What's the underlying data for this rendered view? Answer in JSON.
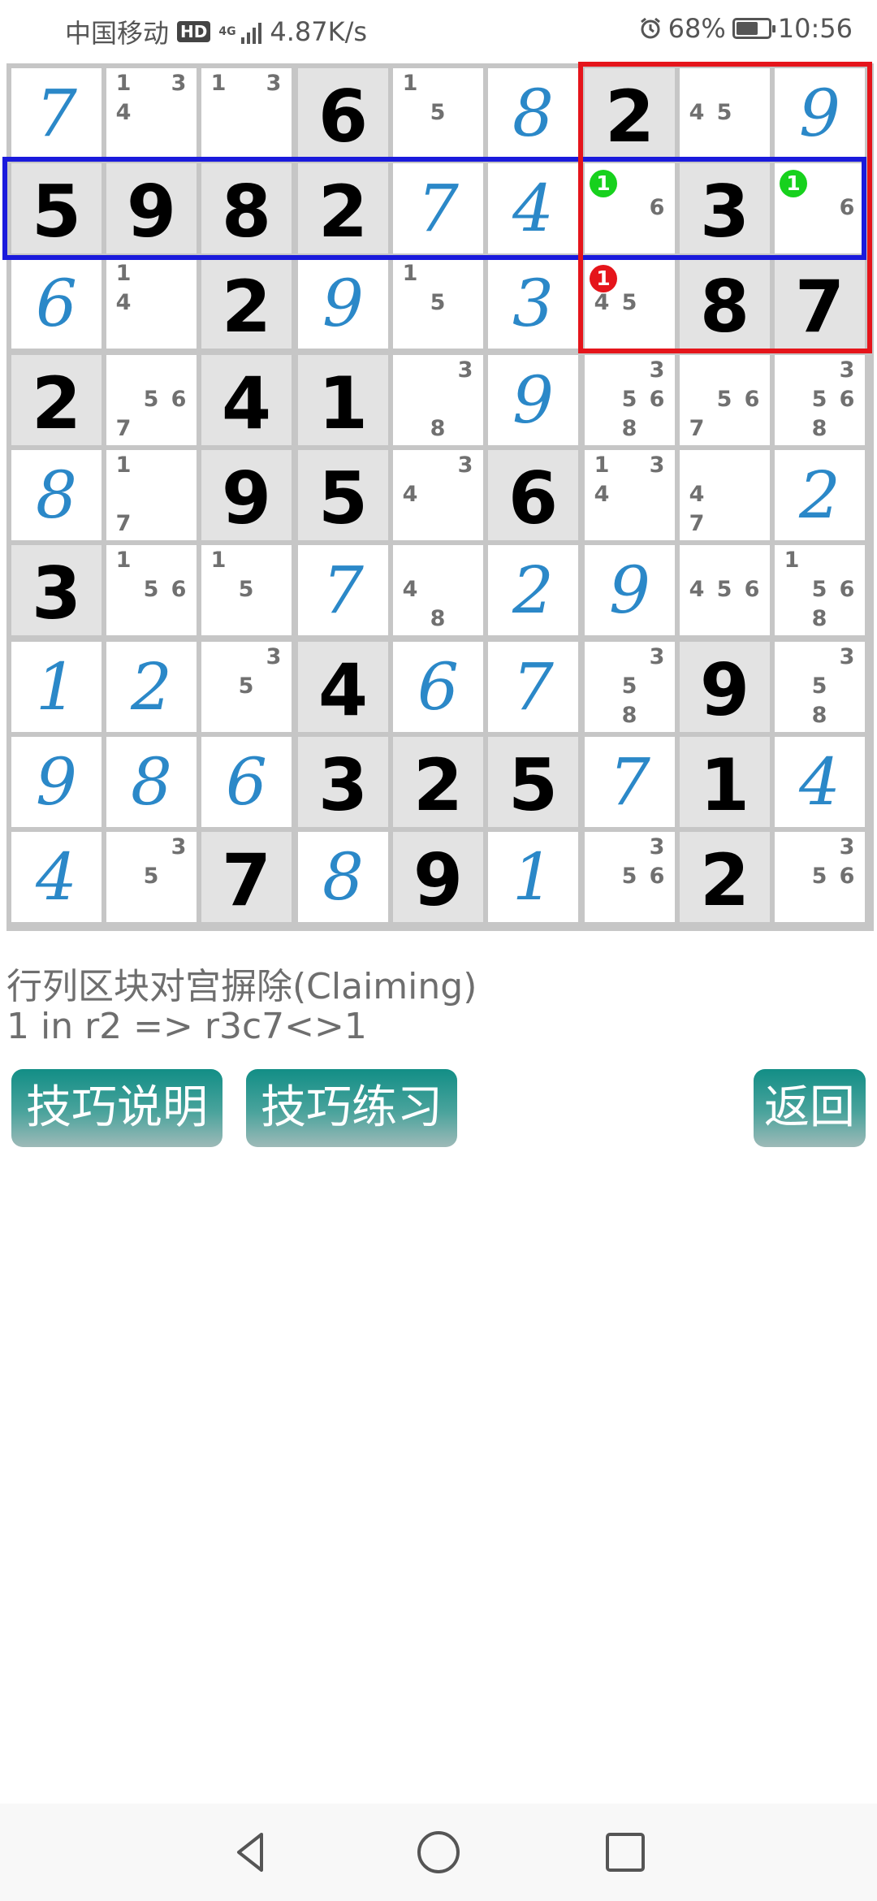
{
  "status_bar": {
    "carrier": "中国移动",
    "hd_badge": "HD",
    "network_type": "4G",
    "speed": "4.87K/s",
    "battery_pct": "68%",
    "time": "10:56"
  },
  "grid": {
    "cells": [
      [
        {
          "u": "7"
        },
        {
          "c": [
            1,
            3,
            4
          ]
        },
        {
          "c": [
            1,
            3
          ]
        },
        {
          "g": "6"
        },
        {
          "c": [
            1,
            5
          ]
        },
        {
          "u": "8"
        },
        {
          "g": "2"
        },
        {
          "c": [
            4,
            5
          ]
        },
        {
          "u": "9"
        }
      ],
      [
        {
          "g": "5"
        },
        {
          "g": "9"
        },
        {
          "g": "8"
        },
        {
          "g": "2"
        },
        {
          "u": "7"
        },
        {
          "u": "4"
        },
        {
          "c": [
            6
          ],
          "m": "1"
        },
        {
          "g": "3"
        },
        {
          "c": [
            6
          ],
          "m": "1"
        }
      ],
      [
        {
          "u": "6"
        },
        {
          "c": [
            1,
            4
          ]
        },
        {
          "g": "2"
        },
        {
          "u": "9"
        },
        {
          "c": [
            1,
            5
          ]
        },
        {
          "u": "3"
        },
        {
          "c": [
            4,
            5
          ],
          "m": "1",
          "mc": "red"
        },
        {
          "g": "8"
        },
        {
          "g": "7"
        }
      ],
      [
        {
          "g": "2"
        },
        {
          "c": [
            5,
            6,
            7
          ]
        },
        {
          "g": "4"
        },
        {
          "g": "1"
        },
        {
          "c": [
            3,
            8
          ]
        },
        {
          "u": "9"
        },
        {
          "c": [
            3,
            5,
            6,
            8
          ]
        },
        {
          "c": [
            5,
            6,
            7
          ]
        },
        {
          "c": [
            3,
            5,
            6,
            8
          ]
        }
      ],
      [
        {
          "u": "8"
        },
        {
          "c": [
            1,
            7
          ]
        },
        {
          "g": "9"
        },
        {
          "g": "5"
        },
        {
          "c": [
            3,
            4
          ]
        },
        {
          "g": "6"
        },
        {
          "c": [
            1,
            3,
            4
          ]
        },
        {
          "c": [
            4,
            7
          ]
        },
        {
          "u": "2"
        }
      ],
      [
        {
          "g": "3"
        },
        {
          "c": [
            1,
            5,
            6
          ]
        },
        {
          "c": [
            1,
            5
          ]
        },
        {
          "u": "7"
        },
        {
          "c": [
            4,
            8
          ]
        },
        {
          "u": "2"
        },
        {
          "u": "9"
        },
        {
          "c": [
            4,
            5,
            6
          ]
        },
        {
          "c": [
            1,
            5,
            6,
            8
          ]
        }
      ],
      [
        {
          "u": "1"
        },
        {
          "u": "2"
        },
        {
          "c": [
            3,
            5
          ]
        },
        {
          "g": "4"
        },
        {
          "u": "6"
        },
        {
          "u": "7"
        },
        {
          "c": [
            3,
            5,
            8
          ]
        },
        {
          "g": "9"
        },
        {
          "c": [
            3,
            5,
            8
          ]
        }
      ],
      [
        {
          "u": "9"
        },
        {
          "u": "8"
        },
        {
          "u": "6"
        },
        {
          "g": "3"
        },
        {
          "g": "2"
        },
        {
          "g": "5"
        },
        {
          "u": "7"
        },
        {
          "g": "1"
        },
        {
          "u": "4"
        }
      ],
      [
        {
          "u": "4"
        },
        {
          "c": [
            3,
            5
          ]
        },
        {
          "g": "7"
        },
        {
          "u": "8"
        },
        {
          "g": "9"
        },
        {
          "u": "1"
        },
        {
          "c": [
            3,
            5,
            6
          ]
        },
        {
          "g": "2"
        },
        {
          "c": [
            3,
            5,
            6
          ]
        }
      ]
    ],
    "highlights": [
      {
        "name": "row-2-highlight",
        "color": "#1a1adc"
      },
      {
        "name": "box-3-highlight",
        "color": "#e5151b"
      }
    ],
    "marker_green": "#17d11d",
    "marker_red": "#e5151b"
  },
  "hint": {
    "technique_name": "行列区块对宫摒除(Claiming)",
    "elimination": "1 in r2 => r3c7<>1"
  },
  "buttons": {
    "explain": "技巧说明",
    "practice": "技巧练习",
    "back": "返回"
  },
  "nav": {
    "back_icon": "triangle-back-icon",
    "home_icon": "circle-home-icon",
    "recents_icon": "square-recents-icon"
  }
}
